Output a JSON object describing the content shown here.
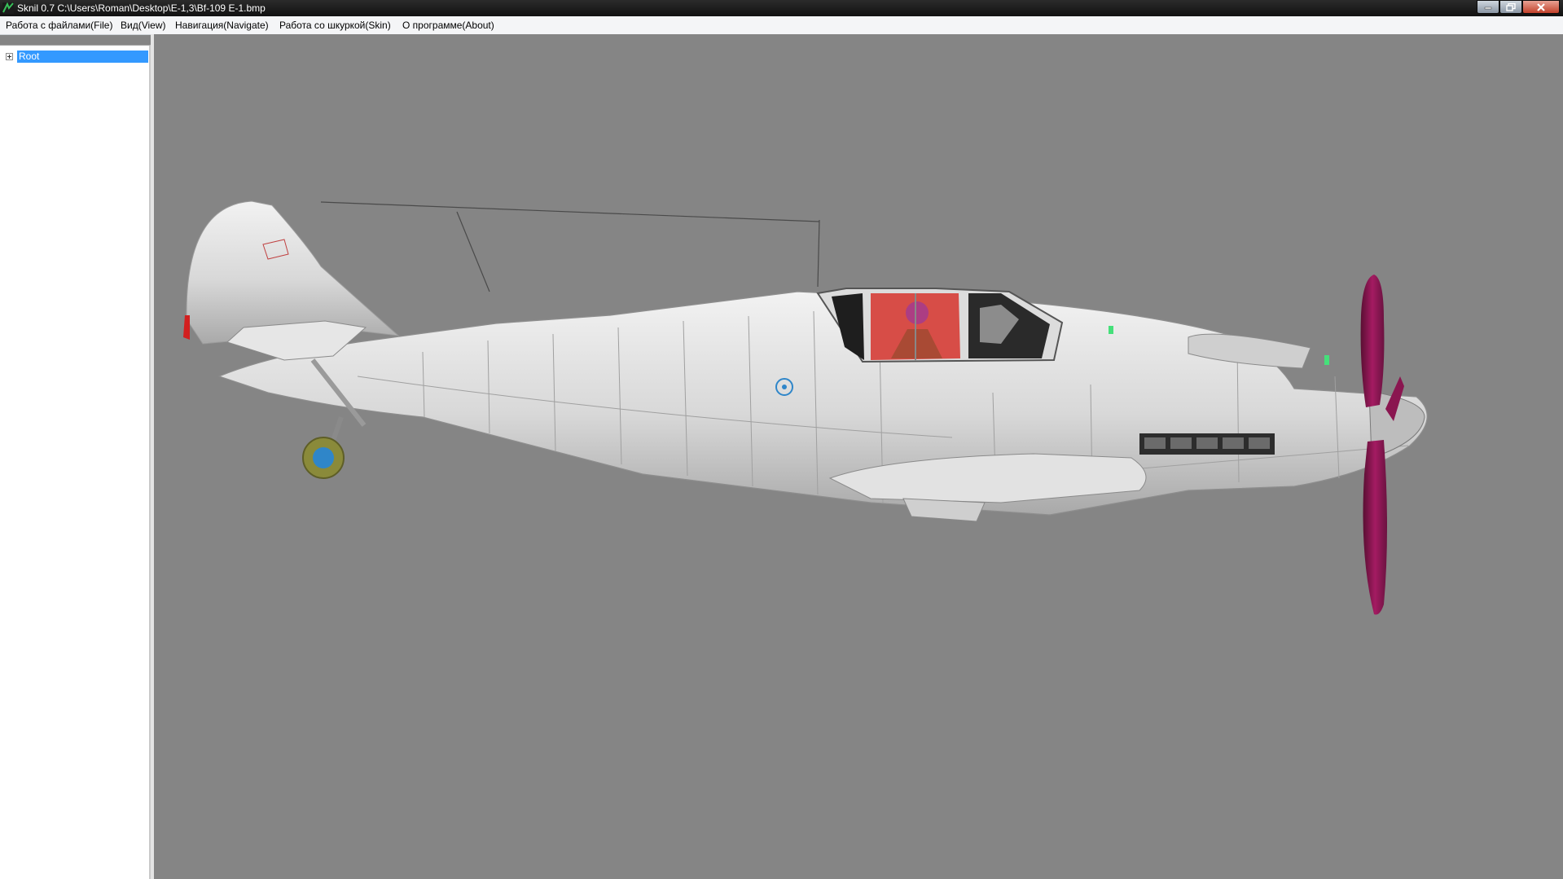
{
  "window": {
    "title": "Sknil 0.7   C:\\Users\\Roman\\Desktop\\E-1,3\\Bf-109 E-1.bmp",
    "controls": {
      "minimize": "minimize-icon",
      "maximize": "maximize-icon",
      "close": "close-icon"
    }
  },
  "menu": {
    "items": [
      {
        "label": "Работа с файлами(File)"
      },
      {
        "label": "Вид(View)"
      },
      {
        "label": "Навигация(Navigate)"
      },
      {
        "label": "Работа со шкуркой(Skin)"
      },
      {
        "label": "О программе(About)"
      }
    ]
  },
  "tree": {
    "root": {
      "label": "Root",
      "expanded": false,
      "selected": true
    }
  },
  "viewport": {
    "background": "#858585",
    "model": "Bf-109 E-1",
    "colors": {
      "fuselage": "#dcdcdc",
      "canopy_tint": "#d6403a",
      "propeller": "#9b1a5a",
      "wheel_tire": "#8a8a3a",
      "wheel_hub": "#2f86c9"
    }
  },
  "colors": {
    "selection": "#3399ff",
    "menubar": "#f4f5f7",
    "titlebar": "#111111"
  }
}
